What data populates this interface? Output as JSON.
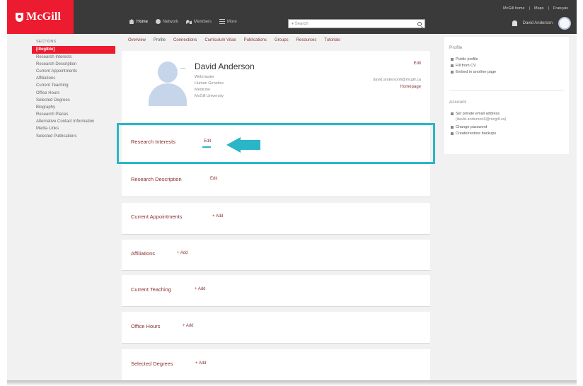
{
  "header": {
    "brand": "McGill",
    "nav": [
      {
        "label": "Home",
        "icon": "home-icon"
      },
      {
        "label": "Network",
        "icon": "network-icon"
      },
      {
        "label": "Members",
        "icon": "members-icon"
      },
      {
        "label": "More",
        "icon": "menu-icon"
      }
    ],
    "search_placeholder": "▾ Search",
    "top_links": [
      "McGill home",
      "Maps",
      "Français"
    ],
    "user_name": "David Anderson"
  },
  "sidebar": {
    "heading": "SECTIONS",
    "items": [
      {
        "label": "[illegible]",
        "active": true
      },
      {
        "label": "Research Interests"
      },
      {
        "label": "Research Description"
      },
      {
        "label": "Current Appointments"
      },
      {
        "label": "Affiliations"
      },
      {
        "label": "Current Teaching"
      },
      {
        "label": "Office Hours"
      },
      {
        "label": "Selected Degrees"
      },
      {
        "label": "Biography"
      },
      {
        "label": "Research Places"
      },
      {
        "label": "Alternative Contact Information"
      },
      {
        "label": "Media Links"
      },
      {
        "label": "Selected Publications"
      }
    ]
  },
  "subtabs": [
    "Overview",
    "Profile",
    "Connections",
    "Curriculum Vitae",
    "Publications",
    "Groups",
    "Resources",
    "Tutorials"
  ],
  "profile": {
    "name": "David Anderson",
    "dash": "—",
    "meta_lines": [
      "Webmaster",
      "Human Genetics",
      "Medicine",
      "McGill University"
    ],
    "edit": "Edit",
    "email": "david.anderson6@mcgill.ca",
    "homepage": "Homepage"
  },
  "sections": {
    "research_interests": {
      "label": "Research Interests",
      "action": "Edit"
    },
    "research_description": {
      "label": "Research Description",
      "action": "Edit"
    },
    "current_appointments": {
      "label": "Current Appointments",
      "action": "+ Add"
    },
    "affiliations": {
      "label": "Affiliations",
      "action": "+ Add"
    },
    "current_teaching": {
      "label": "Current Teaching",
      "action": "+ Add"
    },
    "office_hours": {
      "label": "Office Hours",
      "action": "+ Add"
    },
    "selected_degrees": {
      "label": "Selected Degrees",
      "action": "+ Add"
    }
  },
  "right_panel": {
    "profile_heading": "Profile",
    "profile_items": [
      {
        "label": "Public profile",
        "icon": "eye-icon"
      },
      {
        "label": "Fill from CV",
        "icon": "upload-icon"
      },
      {
        "label": "Embed in another page",
        "icon": "link-icon"
      }
    ],
    "account_heading": "Account",
    "account_items": [
      {
        "label": "Set private email address",
        "sub": "(david.anderson6@mcgill.ca)",
        "icon": "lock-icon"
      },
      {
        "label": "Change password",
        "icon": "key-icon"
      },
      {
        "label": "Create/restore backups",
        "icon": "archive-icon"
      }
    ]
  },
  "colors": {
    "brand_red": "#ed1b2f",
    "topbar": "#3a3a3a",
    "highlight_teal": "#2bb5c9",
    "link_maroon": "#8b2d2d",
    "background": "#f1f1f1"
  }
}
